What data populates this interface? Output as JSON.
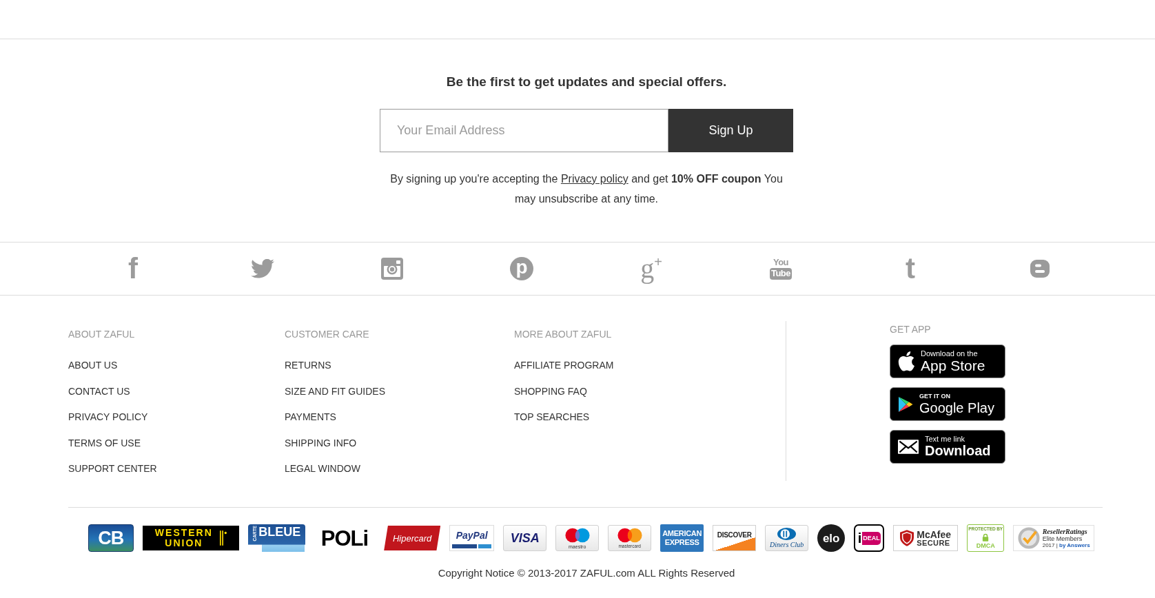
{
  "newsletter": {
    "heading": "Be the first to get updates and special offers.",
    "email": {
      "placeholder": "Your Email Address"
    },
    "button": "Sign Up",
    "disclaimer": {
      "before": "By signing up you're accepting the",
      "link": "Privacy policy",
      "after": "and get **10% OFF coupon** You may unsubscribe at any time."
    }
  },
  "social_links": [
    {
      "kind": "letter",
      "text": "f"
    },
    {
      "kind": "bird"
    },
    {
      "kind": "camera"
    },
    {
      "kind": "disc",
      "text": "p"
    },
    {
      "kind": "serif",
      "text": "g$^{+}$"
    },
    {
      "kind": "stack",
      "lines": [
        "You",
        "Tube"
      ]
    },
    {
      "kind": "letter",
      "text": "t"
    },
    {
      "kind": "tile"
    }
  ],
  "footer_columns": [
    {
      "heading": "ABOUT ZAFUL",
      "links": [
        "ABOUT US",
        "CONTACT US",
        "PRIVACY POLICY",
        "TERMS OF USE",
        "SUPPORT CENTER"
      ]
    },
    {
      "heading": "CUSTOMER CARE",
      "links": [
        "RETURNS",
        "SIZE AND FIT GUIDES",
        "PAYMENTS",
        "SHIPPING INFO",
        "LEGAL WINDOW"
      ]
    },
    {
      "heading": "MORE ABOUT ZAFUL",
      "links": [
        "AFFILIATE PROGRAM",
        "SHOPPING FAQ",
        "TOP SEARCHES"
      ]
    }
  ],
  "get_app": {
    "heading": "GET APP",
    "badges": [
      {
        "kind": "apple",
        "small": "Download on the",
        "large": "App Store"
      },
      {
        "kind": "play",
        "small": "GET IT ON",
        "large": "Google Play"
      },
      {
        "kind": "envelope",
        "small": "Text me link",
        "large": "Download"
      }
    ]
  },
  "payment_logos": [
    {
      "kind": "cb",
      "lines": [
        "CB"
      ]
    },
    {
      "kind": "wu",
      "lines": [
        "WESTERN",
        "UNION"
      ]
    },
    {
      "kind": "bleue",
      "lines": [
        "CARTE",
        "BLEUE"
      ]
    },
    {
      "kind": "poli",
      "lines": [
        "POLi"
      ]
    },
    {
      "kind": "hipercard",
      "lines": [
        "Hipercard"
      ]
    },
    {
      "kind": "paypal",
      "lines": [
        "PayPal"
      ]
    },
    {
      "kind": "visa",
      "lines": [
        "VISA"
      ]
    },
    {
      "kind": "maestro",
      "lines": [
        "maestro"
      ]
    },
    {
      "kind": "mastercard",
      "lines": [
        "mastercard"
      ]
    },
    {
      "kind": "amex",
      "lines": [
        "AMERICAN",
        "EXPRESS"
      ]
    },
    {
      "kind": "discover",
      "lines": [
        "DISCOVER"
      ]
    },
    {
      "kind": "diners",
      "lines": [
        "Diners Club"
      ]
    },
    {
      "kind": "elo",
      "lines": [
        "elo"
      ]
    },
    {
      "kind": "ideal",
      "lines": [
        "i",
        "DEAL"
      ]
    },
    {
      "kind": "mcafee",
      "lines": [
        "McAfee",
        "SECURE"
      ]
    },
    {
      "kind": "dmca",
      "lines": [
        "PROTECTED BY",
        "DMCA"
      ]
    },
    {
      "kind": "reseller",
      "lines": [
        "ResellerRatings",
        "Elite Members",
        "2017 | **by Answers**"
      ]
    }
  ],
  "copyright": "Copyright Notice © 2013-2017 ZAFUL.com ALL Rights Reserved"
}
